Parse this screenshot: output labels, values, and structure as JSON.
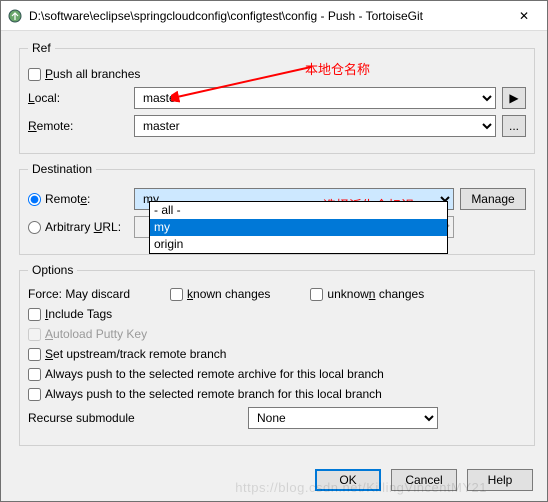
{
  "titlebar": {
    "title": "D:\\software\\eclipse\\springcloudconfig\\configtest\\config - Push - TortoiseGit",
    "close": "✕"
  },
  "ref": {
    "legend": "Ref",
    "push_all": "Push all branches",
    "local_label": "Local:",
    "local_value": "master",
    "remote_label": "Remote:",
    "remote_value": "master",
    "play": "▶",
    "dots": "..."
  },
  "dest": {
    "legend": "Destination",
    "remote_label": "Remote:",
    "remote_value": "my",
    "manage": "Manage",
    "arb_label": "Arbitrary URL:",
    "options": {
      "all": "- all -",
      "my": "my",
      "origin": "origin"
    }
  },
  "opts": {
    "legend": "Options",
    "force_label": "Force: May discard",
    "known": "known changes",
    "unknown": "unknown changes",
    "include_tags": "Include Tags",
    "autoload": "Autoload Putty Key",
    "set_upstream": "Set upstream/track remote branch",
    "always_archive": "Always push to the selected remote archive for this local branch",
    "always_branch": "Always push to the selected remote branch for this local branch",
    "recurse_label": "Recurse submodule",
    "recurse_value": "None"
  },
  "annotations": {
    "local_repo": "本地仓名称",
    "fork_id": "选择派生仓标识"
  },
  "buttons": {
    "ok": "OK",
    "cancel": "Cancel",
    "help": "Help"
  },
  "watermark": "https://blog.csdn.net/KillingVincentMY21"
}
